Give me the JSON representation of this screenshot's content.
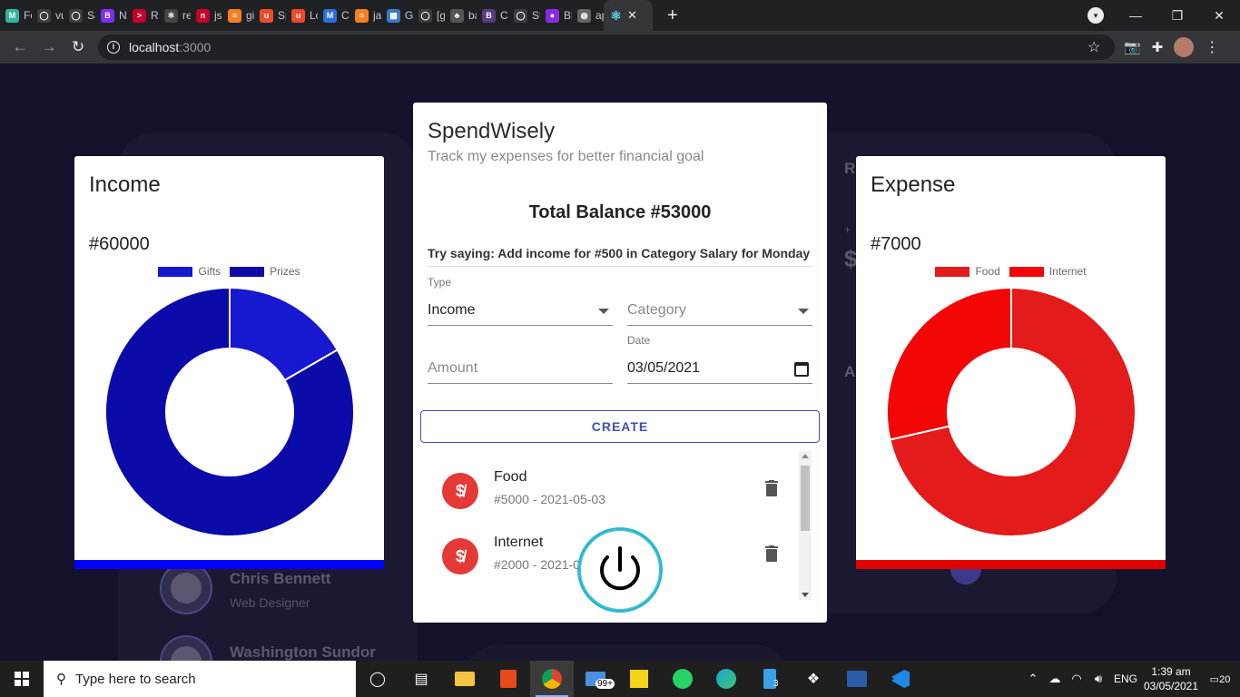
{
  "browser": {
    "tabs": [
      {
        "label": "Fo",
        "favicon": "#2fb5a0",
        "glyph": "M"
      },
      {
        "label": "vu",
        "favicon": "#3c3c3c",
        "glyph": "◯"
      },
      {
        "label": "Sa",
        "favicon": "#3c3c3c",
        "glyph": "◯"
      },
      {
        "label": "Na",
        "favicon": "#7b2ff7",
        "glyph": "B"
      },
      {
        "label": "Re",
        "favicon": "#c4002b",
        "glyph": ">"
      },
      {
        "label": "rea",
        "favicon": "#444",
        "glyph": "⚛"
      },
      {
        "label": "jso",
        "favicon": "#c4002b",
        "glyph": "n"
      },
      {
        "label": "git",
        "favicon": "#f48024",
        "glyph": "≡"
      },
      {
        "label": "Sp",
        "favicon": "#ee4b2b",
        "glyph": "u"
      },
      {
        "label": "Lo",
        "favicon": "#ee4b2b",
        "glyph": "u"
      },
      {
        "label": "Cu",
        "favicon": "#2a6fdb",
        "glyph": "M"
      },
      {
        "label": "jav",
        "favicon": "#f48024",
        "glyph": "≡"
      },
      {
        "label": "Gla",
        "favicon": "#3b79c6",
        "glyph": "▦"
      },
      {
        "label": "[ga",
        "favicon": "#3c3c3c",
        "glyph": "◯"
      },
      {
        "label": "ba",
        "favicon": "#555",
        "glyph": "♣"
      },
      {
        "label": "Ca",
        "favicon": "#563d7c",
        "glyph": "B"
      },
      {
        "label": "Sty",
        "favicon": "#3c3c3c",
        "glyph": "◯"
      },
      {
        "label": "Blu",
        "favicon": "#8a2be2",
        "glyph": "●"
      },
      {
        "label": "ap",
        "favicon": "#666",
        "glyph": "◍"
      }
    ],
    "active_tab": {
      "label": "",
      "glyph": "⚛",
      "close": "✕"
    },
    "new_tab": "+",
    "window": {
      "minimize": "—",
      "restore": "❐",
      "close": "✕"
    },
    "url_host": "localhost",
    "url_port": ":3000"
  },
  "background": {
    "letter_r": "R",
    "letter_a": "A",
    "dollar": "$",
    "plus": "+",
    "people": [
      {
        "name": "Chris Bennett",
        "role": "Web Designer"
      },
      {
        "name": "Washington Sundor",
        "role": ""
      }
    ]
  },
  "income": {
    "title": "Income",
    "amount": "#60000",
    "bar_color": "#0000ff"
  },
  "expense": {
    "title": "Expense",
    "amount": "#7000",
    "bar_color": "#e00000"
  },
  "chart_data": [
    {
      "type": "pie",
      "title": "",
      "categories": [
        "Gifts",
        "Prizes"
      ],
      "values": [
        10000,
        50000
      ],
      "colors": [
        "#1818d0",
        "#0b0baa"
      ],
      "legend": "top"
    },
    {
      "type": "pie",
      "title": "",
      "categories": [
        "Food",
        "Internet"
      ],
      "values": [
        5000,
        2000
      ],
      "colors": [
        "#e31b1b",
        "#f20606"
      ],
      "legend": "top"
    }
  ],
  "form": {
    "app_title": "SpendWisely",
    "subtitle": "Track my expenses for better financial goal",
    "balance": "Total Balance #53000",
    "hint": "Try saying: Add income for #500 in Category Salary for Monday ...",
    "type_label": "Type",
    "type_value": "Income",
    "category_placeholder": "Category",
    "amount_placeholder": "Amount",
    "date_label": "Date",
    "date_value": "03/05/2021",
    "create_label": "CREATE"
  },
  "transactions": [
    {
      "category": "Food",
      "detail": "#5000 - 2021-05-03"
    },
    {
      "category": "Internet",
      "detail": "#2000 - 2021-0"
    }
  ],
  "taskbar": {
    "search_placeholder": "Type here to search",
    "mail_badge": "99+",
    "stack_badge": "3",
    "lang": "ENG",
    "time": "1:39 am",
    "date": "03/05/2021",
    "notifications": "20"
  }
}
